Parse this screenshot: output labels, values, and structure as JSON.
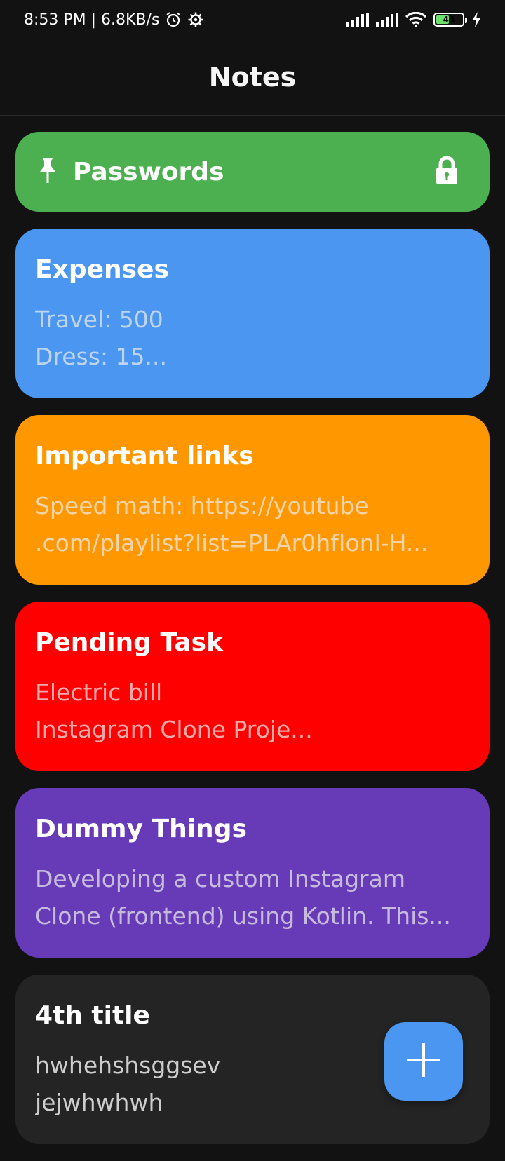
{
  "status_bar": {
    "time_speed": "8:53 PM | 6.8KB/s",
    "battery_level": "45",
    "icons": [
      "alarm-icon",
      "settings-icon",
      "signal-icon",
      "signal-icon",
      "wifi-icon",
      "battery-icon",
      "charging-icon"
    ]
  },
  "app_bar": {
    "title": "Notes"
  },
  "pinned_note": {
    "title": "Passwords",
    "color": "#4caf50",
    "icons": [
      "pin-icon",
      "lock-icon"
    ]
  },
  "notes": [
    {
      "title": "Expenses",
      "body": "Travel: 500\nDress: 15...",
      "color": "#4a96f0"
    },
    {
      "title": "Important links",
      "body": "Speed math: https://youtube\n.com/playlist?list=PLAr0hfIonl-H...",
      "color": "#ff9800"
    },
    {
      "title": "Pending Task",
      "body": "Electric bill\nInstagram Clone Proje...",
      "color": "#ff0000"
    },
    {
      "title": "Dummy Things",
      "body": "Developing a custom Instagram\nClone (frontend) using Kotlin. This...",
      "color": "#673ab7"
    },
    {
      "title": "4th title",
      "body": "hwhehshsggsev\njejwhwhwh",
      "color": "#242424"
    }
  ],
  "fab": {
    "icon": "plus-icon",
    "color": "#4a96f0"
  }
}
